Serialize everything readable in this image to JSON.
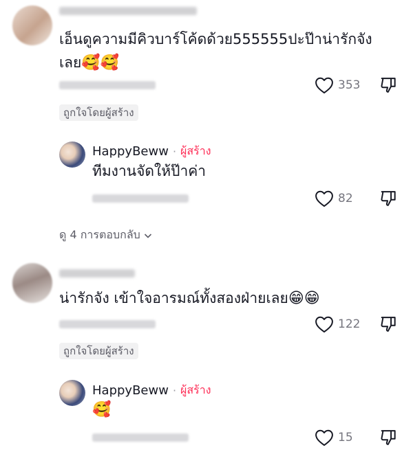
{
  "comment1": {
    "text_line1": "เอ็นดูความมีคิวบาร์โค้ดด้วย555555ปะป๊าน่ารักจัง",
    "text_line2": "เลย",
    "emoji": "🥰🥰",
    "likes": "353",
    "liked_by_creator": "ถูกใจโดยผู้สร้าง"
  },
  "reply1": {
    "author": "HappyBeww",
    "separator": "·",
    "creator_tag": "ผู้สร้าง",
    "text": "ทีมงานจัดให้ป๊าค่า",
    "likes": "82"
  },
  "view_replies": "ดู 4 การตอบกลับ",
  "comment2": {
    "text": "น่ารักจัง เข้าใจอารมณ์ทั้งสองฝ่ายเลย",
    "emoji": "😁😁",
    "likes": "122",
    "liked_by_creator": "ถูกใจโดยผู้สร้าง"
  },
  "reply2": {
    "author": "HappyBeww",
    "separator": "·",
    "creator_tag": "ผู้สร้าง",
    "emoji": "🥰",
    "likes": "15"
  },
  "colors": {
    "creator_tag": "#fe2c55",
    "meta_text": "#75757e"
  },
  "icons": {
    "like": "heart-outline-icon",
    "dislike": "thumbs-down-outline-icon",
    "chevron": "chevron-down-icon"
  }
}
